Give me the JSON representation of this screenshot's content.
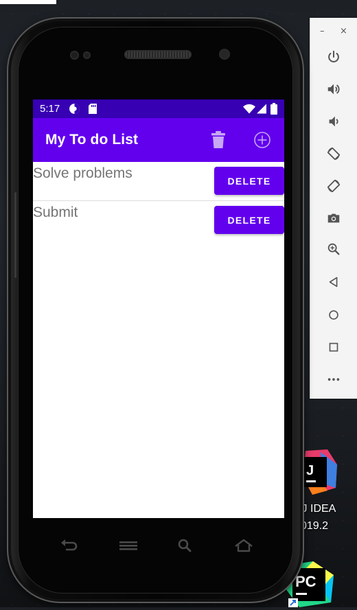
{
  "status_bar": {
    "time": "5:17"
  },
  "app_bar": {
    "title": "My To do List"
  },
  "todos": [
    {
      "text": "Solve problems",
      "delete_label": "DELETE"
    },
    {
      "text": "Submit",
      "delete_label": "DELETE"
    }
  ],
  "emulator_toolbar": {
    "minimize_label": "–",
    "close_label": "×",
    "buttons": [
      "power-icon",
      "volume-up-icon",
      "volume-down-icon",
      "rotate-left-icon",
      "rotate-right-icon",
      "camera-icon",
      "zoom-icon",
      "back-icon",
      "home-icon",
      "overview-icon",
      "more-icon"
    ]
  },
  "desktop": {
    "intellij_label_line1": "iJ IDEA",
    "intellij_label_line2": "019.2",
    "intellij_logo_text": "J",
    "pycharm_logo_text": "PC"
  },
  "colors": {
    "status_bar": "#3700b3",
    "app_bar": "#6200ee",
    "button": "#6200ee",
    "item_text": "#757575"
  }
}
